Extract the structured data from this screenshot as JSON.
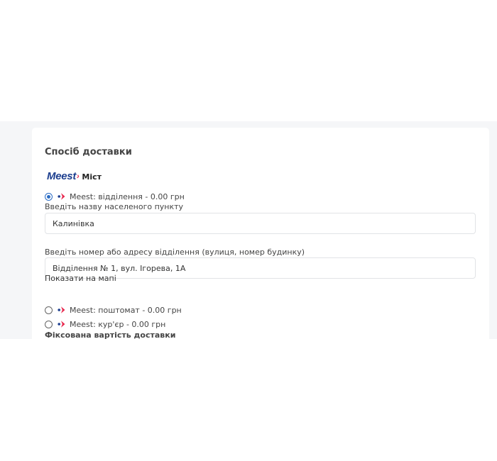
{
  "delivery": {
    "section_title": "Спосіб доставки",
    "brand": {
      "logo_text": "Meest",
      "logo_mark": "›",
      "name": "Міст",
      "logo_color": "#1d3f8f",
      "accent_color": "#e8284d"
    },
    "options": [
      {
        "label": "Meest: відділення - 0.00 грн",
        "selected": true
      },
      {
        "label": "Meest: поштомат - 0.00 грн",
        "selected": false
      },
      {
        "label": "Meest: кур'єр - 0.00 грн",
        "selected": false
      }
    ],
    "city": {
      "label": "Введіть назву населеного пункту",
      "value": "Калинівка"
    },
    "branch": {
      "label": "Введіть номер або адресу відділення (вулиця, номер будинку)",
      "value": "Відділення № 1, вул. Ігорева, 1А"
    },
    "map_link": "Показати на мапі",
    "fixed_cost_note": "Фіксована вартість доставки"
  }
}
